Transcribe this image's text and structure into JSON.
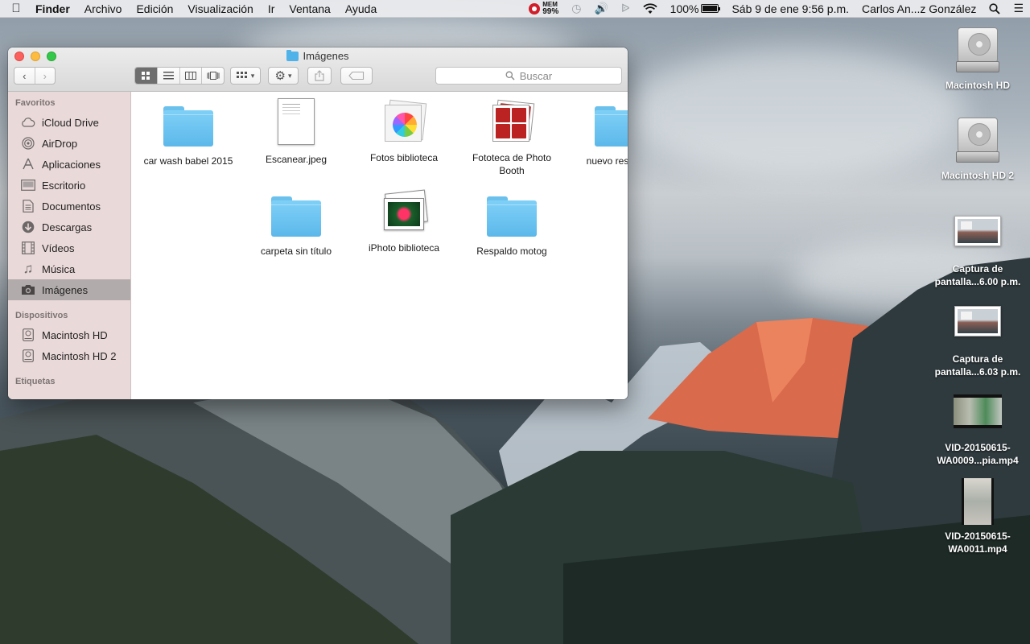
{
  "menubar": {
    "apple": "",
    "app": "Finder",
    "menus": [
      "Archivo",
      "Edición",
      "Visualización",
      "Ir",
      "Ventana",
      "Ayuda"
    ],
    "mem_label": "MEM",
    "mem_value": "99%",
    "battery": "100%",
    "datetime": "Sáb 9 de ene  9:56 p.m.",
    "user": "Carlos An...z González"
  },
  "window": {
    "title": "Imágenes",
    "search_placeholder": "Buscar",
    "view_modes": [
      "icon-view",
      "list-view",
      "column-view",
      "coverflow-view"
    ],
    "active_view": 0
  },
  "sidebar": {
    "favorites_header": "Favoritos",
    "favorites": [
      {
        "label": "iCloud Drive",
        "icon": "cloud-icon"
      },
      {
        "label": "AirDrop",
        "icon": "airdrop-icon"
      },
      {
        "label": "Aplicaciones",
        "icon": "applications-icon"
      },
      {
        "label": "Escritorio",
        "icon": "desktop-icon"
      },
      {
        "label": "Documentos",
        "icon": "document-icon"
      },
      {
        "label": "Descargas",
        "icon": "download-icon"
      },
      {
        "label": "Vídeos",
        "icon": "film-icon"
      },
      {
        "label": "Música",
        "icon": "music-icon"
      },
      {
        "label": "Imágenes",
        "icon": "camera-icon",
        "selected": true
      }
    ],
    "devices_header": "Dispositivos",
    "devices": [
      {
        "label": "Macintosh HD",
        "icon": "disk-icon"
      },
      {
        "label": "Macintosh HD 2",
        "icon": "disk-icon"
      }
    ],
    "tags_header": "Etiquetas"
  },
  "files": [
    {
      "label": "car wash babel 2015",
      "type": "folder"
    },
    {
      "label": "Escanear.jpeg",
      "type": "document"
    },
    {
      "label": "Fotos biblioteca",
      "type": "photos-library"
    },
    {
      "label": "Fototeca de Photo Booth",
      "type": "photo-booth-library"
    },
    {
      "label": "nuevo res moto",
      "type": "folder"
    },
    {
      "label": "carpeta sin título",
      "type": "folder"
    },
    {
      "label": "iPhoto biblioteca",
      "type": "iphoto-library"
    },
    {
      "label": "Respaldo motog",
      "type": "folder"
    }
  ],
  "desktop": [
    {
      "label": "Macintosh HD",
      "type": "hard-disk"
    },
    {
      "label": "Macintosh HD 2",
      "type": "hard-disk"
    },
    {
      "label": "Captura de pantalla...6.00 p.m.",
      "type": "screenshot"
    },
    {
      "label": "Captura de pantalla...6.03 p.m.",
      "type": "screenshot"
    },
    {
      "label": "VID-20150615-WA0009...pia.mp4",
      "type": "video"
    },
    {
      "label": "VID-20150615-WA0011.mp4",
      "type": "video"
    }
  ]
}
